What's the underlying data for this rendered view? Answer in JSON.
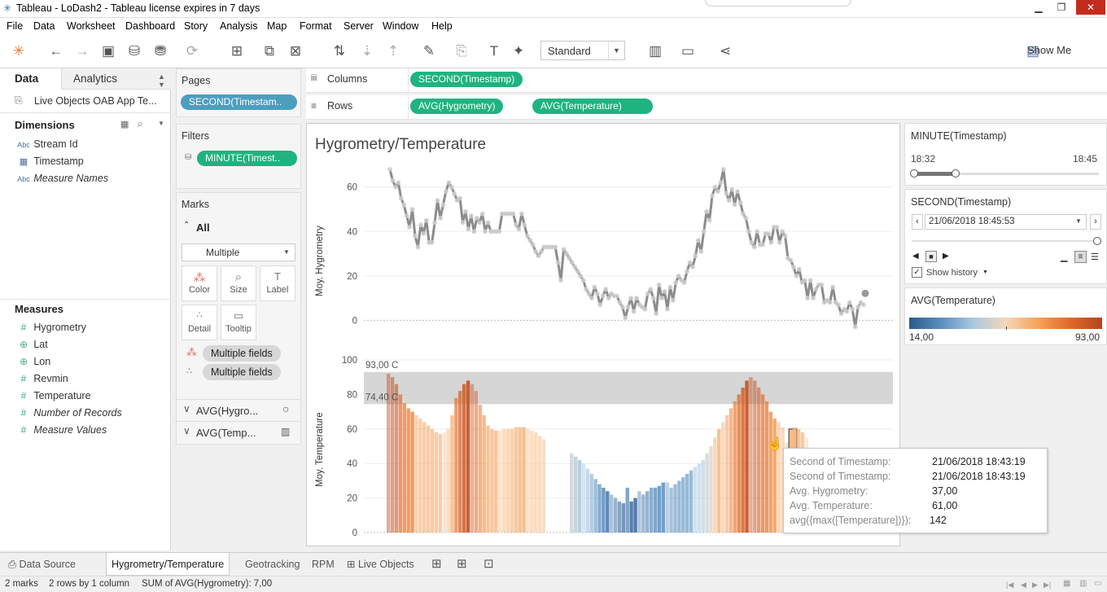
{
  "window": {
    "title": "Tableau - LoDash2 - Tableau license expires in 7 days"
  },
  "menu": [
    "File",
    "Data",
    "Worksheet",
    "Dashboard",
    "Story",
    "Analysis",
    "Map",
    "Format",
    "Server",
    "Window",
    "Help"
  ],
  "toolbar": {
    "mark_size_select": "Standard",
    "show_me": "Show Me"
  },
  "left_pane": {
    "tabs": {
      "data": "Data",
      "analytics": "Analytics"
    },
    "datasource": "Live Objects OAB App Te...",
    "dimensions_title": "Dimensions",
    "dimensions": [
      {
        "label": "Stream Id",
        "icon": "abc-icon",
        "italic": false
      },
      {
        "label": "Timestamp",
        "icon": "calendar-icon",
        "italic": false
      },
      {
        "label": "Measure Names",
        "icon": "abc-icon",
        "italic": true
      }
    ],
    "measures_title": "Measures",
    "measures": [
      {
        "label": "Hygrometry",
        "icon": "measure-icon",
        "italic": false
      },
      {
        "label": "Lat",
        "icon": "globe-icon",
        "italic": false
      },
      {
        "label": "Lon",
        "icon": "globe-icon",
        "italic": false
      },
      {
        "label": "Revmin",
        "icon": "measure-icon",
        "italic": false
      },
      {
        "label": "Temperature",
        "icon": "measure-icon",
        "italic": false
      },
      {
        "label": "Number of Records",
        "icon": "measure-icon",
        "italic": true
      },
      {
        "label": "Measure Values",
        "icon": "measure-icon",
        "italic": true
      }
    ]
  },
  "shelves": {
    "pages_title": "Pages",
    "pages_pill": "SECOND(Timestam..",
    "filters_title": "Filters",
    "filters_pill": "MINUTE(Timest..",
    "columns_label": "Columns",
    "columns_pill": "SECOND(Timestamp)",
    "rows_label": "Rows",
    "rows_pills": [
      "AVG(Hygrometry)",
      "AVG(Temperature)"
    ]
  },
  "marks": {
    "title": "Marks",
    "all": "All",
    "type": "Multiple",
    "buttons": [
      "Color",
      "Size",
      "Label",
      "Detail",
      "Tooltip"
    ],
    "fields": [
      "Multiple fields",
      "Multiple fields"
    ],
    "cards": [
      "AVG(Hygro...",
      "AVG(Temp..."
    ]
  },
  "view": {
    "title": "Hygrometry/Temperature"
  },
  "chart_data": [
    {
      "type": "line",
      "ylabel": "Moy. Hygrometry",
      "ylim": [
        -5,
        72
      ],
      "yticks": [
        "0",
        "20",
        "40",
        "60"
      ],
      "values": [
        68,
        63,
        60,
        62,
        55,
        52,
        47,
        42,
        50,
        38,
        33,
        43,
        39,
        45,
        35,
        35,
        44,
        54,
        46,
        52,
        58,
        62,
        60,
        57,
        54,
        55,
        44,
        49,
        41,
        47,
        40,
        46,
        44,
        48,
        40,
        44,
        40,
        40,
        40,
        40,
        48,
        48,
        48,
        48,
        48,
        43,
        41,
        48,
        43,
        38,
        36,
        34,
        31,
        29,
        31,
        33,
        33,
        33,
        33,
        33,
        26,
        18,
        32,
        30,
        28,
        26,
        24,
        22,
        20,
        18,
        14,
        12,
        10,
        15,
        12,
        7,
        11,
        14,
        10,
        12,
        11,
        11,
        8,
        6,
        1,
        6,
        10,
        4,
        10,
        7,
        6,
        5,
        12,
        14,
        10,
        3,
        16,
        10,
        13,
        5,
        15,
        9,
        17,
        20,
        18,
        17,
        22,
        26,
        24,
        29,
        36,
        31,
        40,
        49,
        45,
        56,
        60,
        58,
        62,
        68,
        57,
        54,
        59,
        52,
        58,
        53,
        48,
        46,
        40,
        35,
        33,
        40,
        34,
        34,
        39,
        39,
        35,
        42,
        42,
        35,
        40,
        38,
        28,
        27,
        24,
        20,
        23,
        17,
        18,
        10,
        18,
        10,
        14,
        16,
        16,
        8,
        9,
        8,
        15,
        8,
        7,
        3,
        5,
        4,
        8,
        5,
        -3,
        6,
        8,
        7
      ]
    },
    {
      "type": "bar",
      "ylabel": "Moy. Temperature",
      "ylim": [
        0,
        100
      ],
      "yticks": [
        "0",
        "20",
        "40",
        "60",
        "80",
        "100"
      ],
      "reference_band": {
        "low": 74.4,
        "high": 93.0,
        "labels": [
          "93,00 C",
          "74,40 C"
        ]
      },
      "color_range": [
        14,
        93
      ],
      "values": [
        92,
        90,
        86,
        80,
        75,
        72,
        70,
        68,
        66,
        64,
        62,
        60,
        58,
        57,
        58,
        60,
        68,
        78,
        82,
        86,
        88,
        86,
        82,
        74,
        68,
        62,
        60,
        59,
        59,
        60,
        60,
        60,
        61,
        61,
        61,
        60,
        59,
        58,
        56,
        54,
        0,
        0,
        0,
        0,
        0,
        0,
        46,
        44,
        42,
        40,
        37,
        34,
        31,
        28,
        26,
        24,
        22,
        20,
        18,
        17,
        26,
        18,
        20,
        24,
        22,
        24,
        26,
        26,
        27,
        29,
        29,
        26,
        28,
        30,
        32,
        34,
        36,
        38,
        40,
        42,
        46,
        50,
        55,
        60,
        64,
        68,
        72,
        76,
        80,
        84,
        88,
        90,
        88,
        84,
        80,
        76,
        70,
        66,
        64,
        61,
        52,
        60,
        61,
        60,
        58,
        55,
        40,
        38,
        38,
        36,
        38,
        36,
        34,
        32,
        30,
        28,
        28,
        30,
        32,
        30,
        28
      ]
    }
  ],
  "tooltip": {
    "rows": [
      {
        "key": "Second of Timestamp:",
        "value": "21/06/2018 18:43:19"
      },
      {
        "key": "Second of Timestamp:",
        "value": "21/06/2018 18:43:19"
      },
      {
        "key": "Avg. Hygrometry:",
        "value": "37,00"
      },
      {
        "key": "Avg. Temperature:",
        "value": "61,00"
      },
      {
        "key": "avg({max([Temperature])}):",
        "value": "142"
      }
    ]
  },
  "right_panel": {
    "minute": {
      "title": "MINUTE(Timestamp)",
      "min": "18:32",
      "max": "18:45"
    },
    "second": {
      "title": "SECOND(Timestamp)",
      "value": "21/06/2018 18:45:53",
      "show_history": "Show history"
    },
    "legend": {
      "title": "AVG(Temperature)",
      "min": "14,00",
      "max": "93,00",
      "colors": [
        "#2a5a8c",
        "#5b8fc0",
        "#a9c9e0",
        "#f5d7b8",
        "#f7a15a",
        "#e06a2a",
        "#b5461b"
      ]
    }
  },
  "tabs": [
    "Data Source",
    "Hygrometry/Temperature",
    "Geotracking",
    "RPM",
    "Live Objects"
  ],
  "status": {
    "marks": "2 marks",
    "rows": "2 rows by 1 column",
    "sum": "SUM of AVG(Hygrometry): 7,00"
  }
}
